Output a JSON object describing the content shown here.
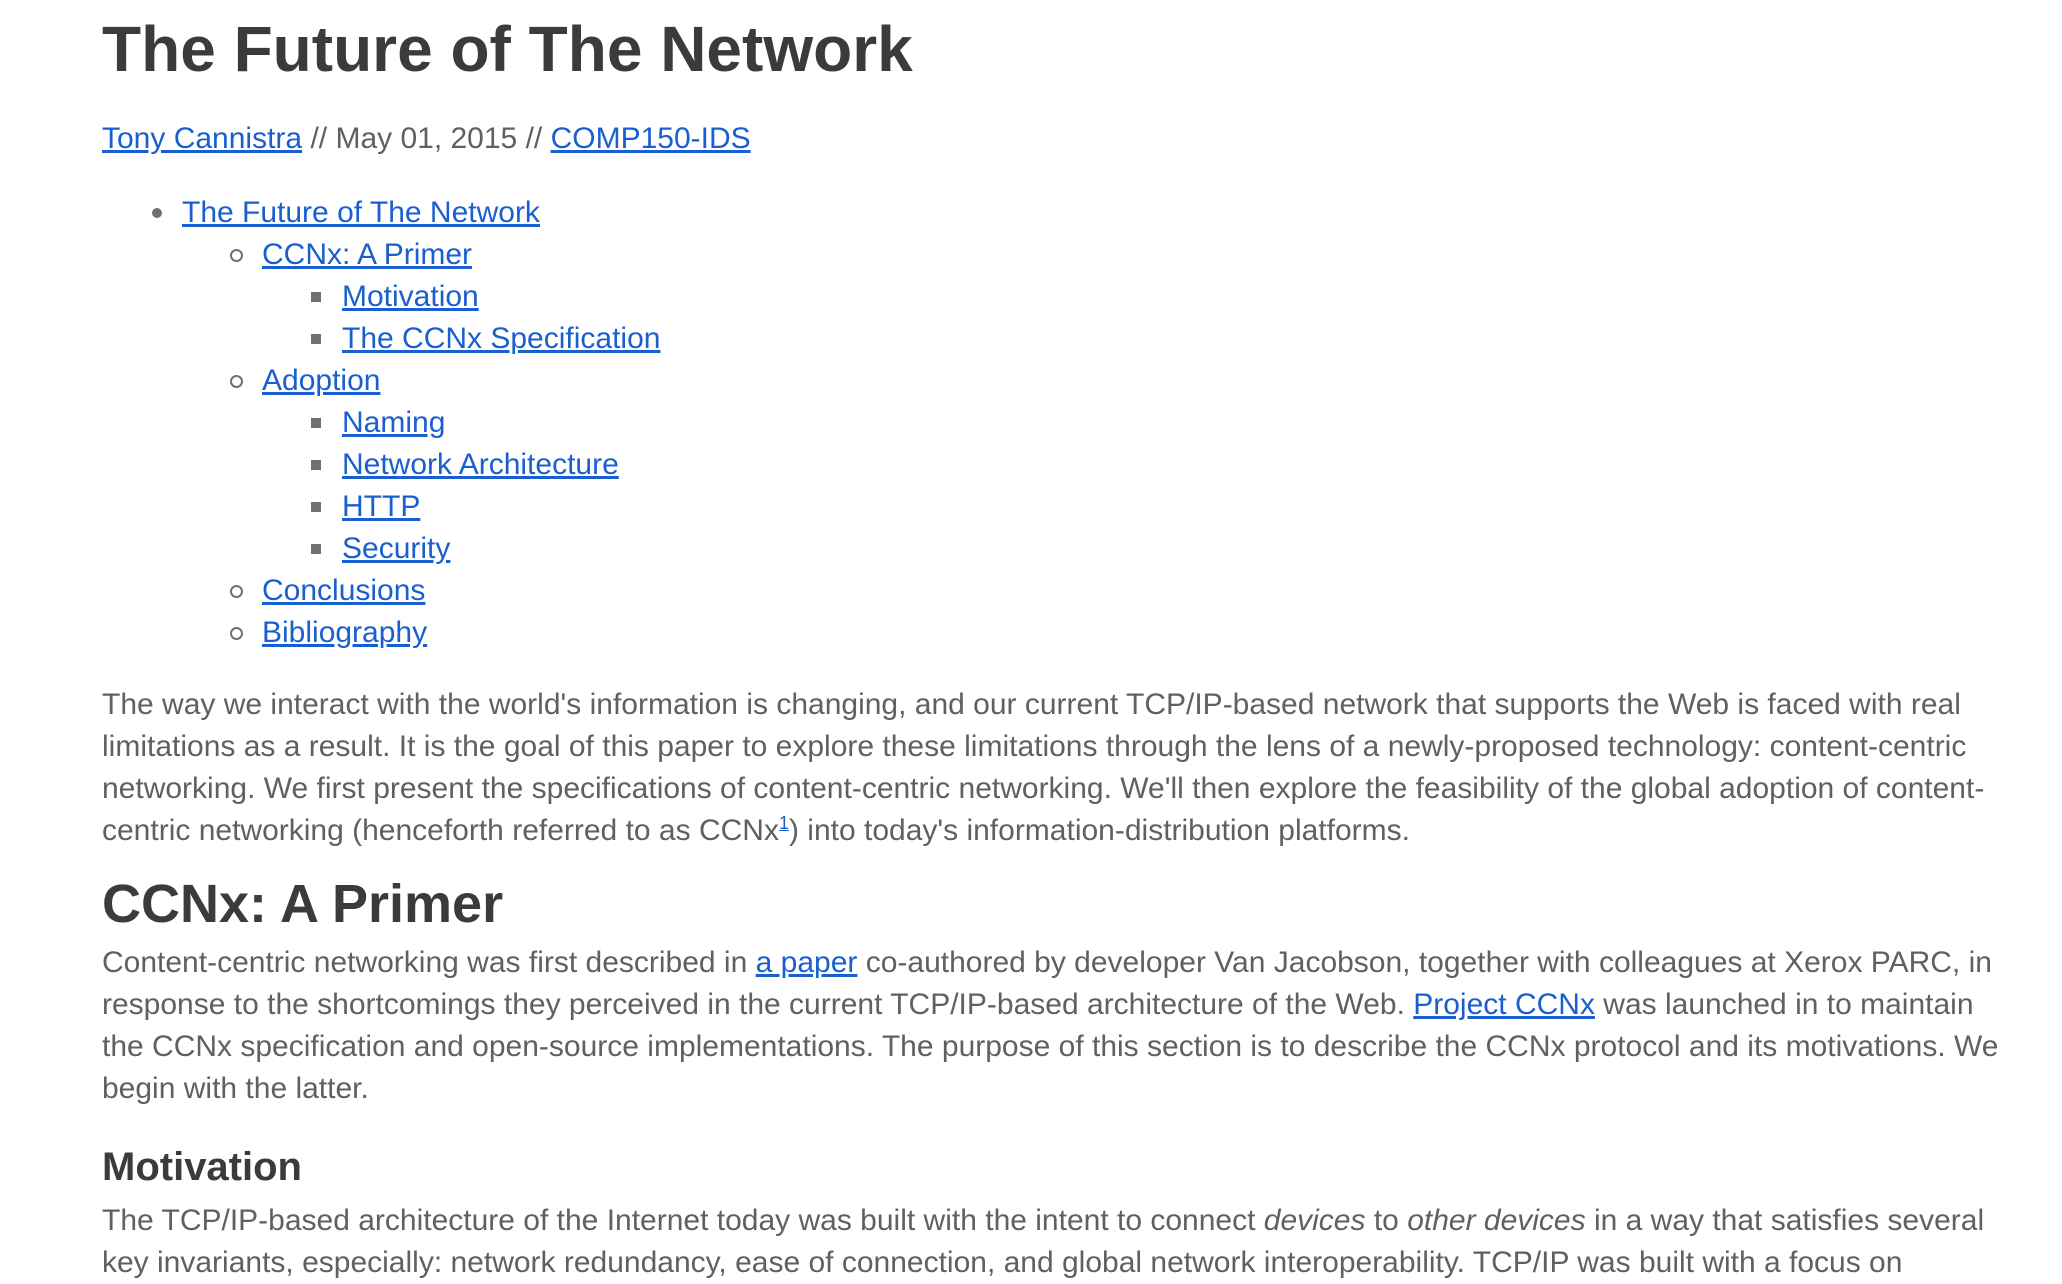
{
  "title": "The Future of The Network",
  "byline": {
    "author": "Tony Cannistra",
    "sep1": " // ",
    "date": "May 01, 2015",
    "sep2": " // ",
    "course": "COMP150-IDS"
  },
  "toc": [
    {
      "level": 1,
      "label": "The Future of The Network"
    },
    {
      "level": 2,
      "label": "CCNx: A Primer"
    },
    {
      "level": 3,
      "label": "Motivation"
    },
    {
      "level": 3,
      "label": "The CCNx Specification"
    },
    {
      "level": 2,
      "label": "Adoption"
    },
    {
      "level": 3,
      "label": "Naming"
    },
    {
      "level": 3,
      "label": "Network Architecture"
    },
    {
      "level": 3,
      "label": "HTTP"
    },
    {
      "level": 3,
      "label": "Security"
    },
    {
      "level": 2,
      "label": "Conclusions"
    },
    {
      "level": 2,
      "label": "Bibliography"
    }
  ],
  "intro": {
    "text_before": "The way we interact with the world's information is changing, and our current TCP/IP-based network that supports the Web is faced with real limitations as a result. It is the goal of this paper to explore these limitations through the lens of a newly-proposed technology: content-centric networking. We first present the specifications of content-centric networking. We'll then explore the feasibility of the global adoption of content-centric networking (henceforth referred to as CCNx",
    "footnote": "1",
    "text_after": ") into today's information-distribution platforms."
  },
  "primer": {
    "heading": "CCNx: A Primer",
    "t1": "Content-centric networking was first described in ",
    "link1": "a paper",
    "t2": " co-authored by developer Van Jacobson, together with colleagues at Xerox PARC, in response to the shortcomings they perceived in the current TCP/IP-based architecture of the Web. ",
    "link2": "Project CCNx",
    "t3": " was launched in to maintain the CCNx specification and open-source implementations. The purpose of this section is to describe the CCNx protocol and its motivations. We begin with the latter."
  },
  "motivation": {
    "heading": "Motivation",
    "t1": "The TCP/IP-based architecture of the Internet today was built with the intent to connect ",
    "em1": "devices",
    "t2": " to ",
    "em2": "other devices",
    "t3": " in a way that satisfies several key invariants, especially: network redundancy, ease of connection, and global network interoperability. TCP/IP was built with a focus on"
  }
}
